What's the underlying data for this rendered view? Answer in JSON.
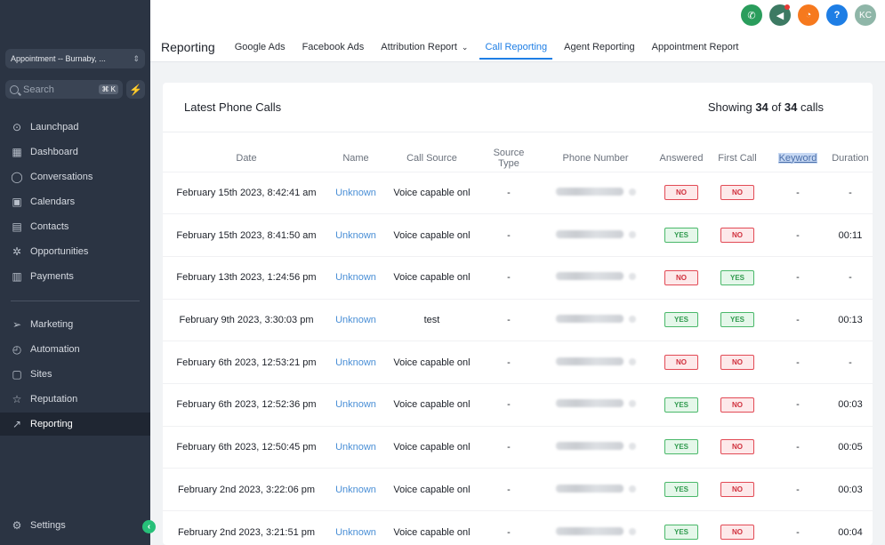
{
  "sidebar": {
    "location": "Appointment -- Burnaby, ...",
    "search_placeholder": "Search",
    "search_shortcut": "⌘ K",
    "items": [
      {
        "label": "Launchpad",
        "icon": "rocket-icon"
      },
      {
        "label": "Dashboard",
        "icon": "grid-icon"
      },
      {
        "label": "Conversations",
        "icon": "chat-icon"
      },
      {
        "label": "Calendars",
        "icon": "calendar-icon"
      },
      {
        "label": "Contacts",
        "icon": "contacts-icon"
      },
      {
        "label": "Opportunities",
        "icon": "opportunities-icon"
      },
      {
        "label": "Payments",
        "icon": "receipt-icon"
      },
      {
        "label": "Marketing",
        "icon": "send-icon"
      },
      {
        "label": "Automation",
        "icon": "automation-icon"
      },
      {
        "label": "Sites",
        "icon": "sites-icon"
      },
      {
        "label": "Reputation",
        "icon": "star-icon"
      },
      {
        "label": "Reporting",
        "icon": "trend-icon"
      }
    ],
    "settings_label": "Settings"
  },
  "topbar": {
    "avatar_initials": "KC",
    "help_glyph": "?",
    "title": "Reporting",
    "tabs": [
      {
        "label": "Google Ads"
      },
      {
        "label": "Facebook Ads"
      },
      {
        "label": "Attribution Report"
      },
      {
        "label": "Call Reporting"
      },
      {
        "label": "Agent Reporting"
      },
      {
        "label": "Appointment Report"
      }
    ],
    "active_tab": "Call Reporting"
  },
  "card": {
    "title": "Latest Phone Calls",
    "count_prefix": "Showing",
    "count_shown": "34",
    "count_of": "of",
    "count_total": "34",
    "count_suffix": "calls"
  },
  "table": {
    "headers": {
      "date": "Date",
      "name": "Name",
      "call_source": "Call Source",
      "source_type": "Source Type",
      "phone": "Phone Number",
      "answered": "Answered",
      "first_call": "First Call",
      "keyword": "Keyword",
      "duration": "Duration"
    },
    "rows": [
      {
        "date": "February 15th 2023, 8:42:41 am",
        "name": "Unknown",
        "source": "Voice capable onl",
        "stype": "-",
        "answered": "NO",
        "first": "NO",
        "keyword": "-",
        "duration": "-"
      },
      {
        "date": "February 15th 2023, 8:41:50 am",
        "name": "Unknown",
        "source": "Voice capable onl",
        "stype": "-",
        "answered": "YES",
        "first": "NO",
        "keyword": "-",
        "duration": "00:11"
      },
      {
        "date": "February 13th 2023, 1:24:56 pm",
        "name": "Unknown",
        "source": "Voice capable onl",
        "stype": "-",
        "answered": "NO",
        "first": "YES",
        "keyword": "-",
        "duration": "-"
      },
      {
        "date": "February 9th 2023, 3:30:03 pm",
        "name": "Unknown",
        "source": "test",
        "stype": "-",
        "answered": "YES",
        "first": "YES",
        "keyword": "-",
        "duration": "00:13"
      },
      {
        "date": "February 6th 2023, 12:53:21 pm",
        "name": "Unknown",
        "source": "Voice capable onl",
        "stype": "-",
        "answered": "NO",
        "first": "NO",
        "keyword": "-",
        "duration": "-"
      },
      {
        "date": "February 6th 2023, 12:52:36 pm",
        "name": "Unknown",
        "source": "Voice capable onl",
        "stype": "-",
        "answered": "YES",
        "first": "NO",
        "keyword": "-",
        "duration": "00:03"
      },
      {
        "date": "February 6th 2023, 12:50:45 pm",
        "name": "Unknown",
        "source": "Voice capable onl",
        "stype": "-",
        "answered": "YES",
        "first": "NO",
        "keyword": "-",
        "duration": "00:05"
      },
      {
        "date": "February 2nd 2023, 3:22:06 pm",
        "name": "Unknown",
        "source": "Voice capable onl",
        "stype": "-",
        "answered": "YES",
        "first": "NO",
        "keyword": "-",
        "duration": "00:03"
      },
      {
        "date": "February 2nd 2023, 3:21:51 pm",
        "name": "Unknown",
        "source": "Voice capable onl",
        "stype": "-",
        "answered": "YES",
        "first": "NO",
        "keyword": "-",
        "duration": "00:04"
      }
    ]
  },
  "colors": {
    "sidebar_bg": "#2b3443",
    "accent": "#1e7ee5",
    "yes_green": "#2f9a4d",
    "no_red": "#d0303d"
  }
}
